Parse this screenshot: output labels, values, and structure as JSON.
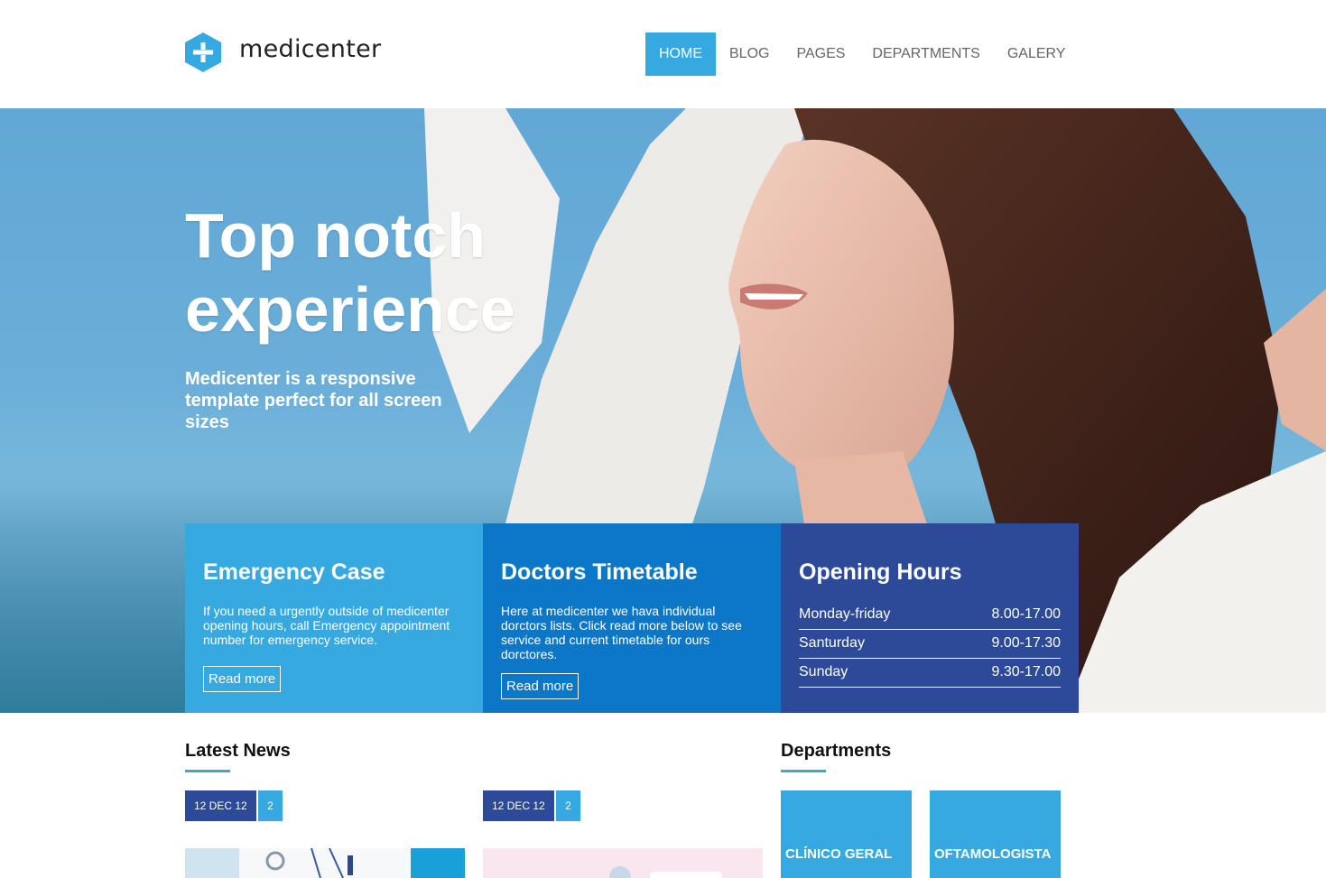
{
  "brand": {
    "name": "medicenter",
    "accent": "#37a9e1",
    "dark_blue": "#2d4a99",
    "mid_blue": "#0c77c6"
  },
  "nav": {
    "items": [
      {
        "label": "HOME",
        "active": true
      },
      {
        "label": "BLOG",
        "active": false
      },
      {
        "label": "PAGES",
        "active": false
      },
      {
        "label": "DEPARTMENTS",
        "active": false
      },
      {
        "label": "GALERY",
        "active": false
      }
    ]
  },
  "hero": {
    "title_line1": "Top notch",
    "title_line2": "experience",
    "subtitle": "Medicenter is a responsive template perfect for all screen sizes"
  },
  "boxes": {
    "emergency": {
      "title": "Emergency Case",
      "text": "If you need a urgently outside of medicenter opening hours, call Emergency appointment number for emergency service.",
      "button": "Read more"
    },
    "timetable": {
      "title": "Doctors Timetable",
      "text": "Here at medicenter we hava individual dorctors lists. Click read more below to see service and current timetable for ours dorctores.",
      "button": "Read more"
    },
    "hours": {
      "title": "Opening Hours",
      "rows": [
        {
          "day": "Monday-friday",
          "time": "8.00-17.00"
        },
        {
          "day": "Santurday",
          "time": "9.00-17.30"
        },
        {
          "day": "Sunday",
          "time": "9.30-17.00"
        }
      ]
    }
  },
  "news": {
    "title": "Latest News",
    "items": [
      {
        "date": "12 DEC 12",
        "comments": "2"
      },
      {
        "date": "12 DEC 12",
        "comments": "2"
      }
    ]
  },
  "departments": {
    "title": "Departments",
    "items": [
      {
        "label": "CLÍNICO GERAL"
      },
      {
        "label": "OFTAMOLOGISTA"
      }
    ]
  }
}
